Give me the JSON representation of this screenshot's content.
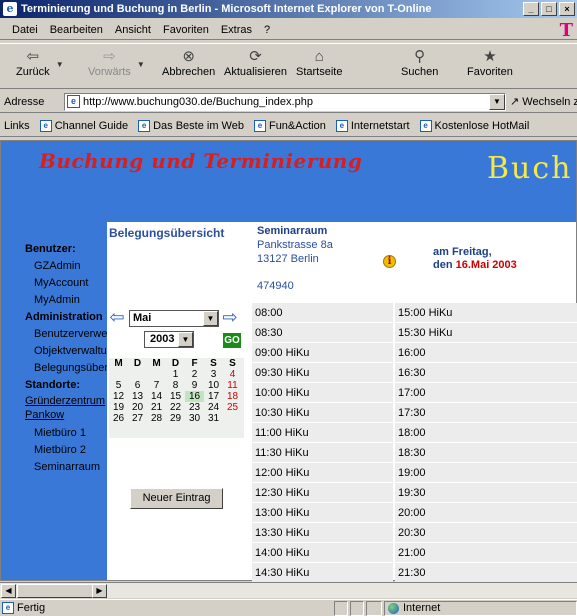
{
  "window": {
    "title": "Terminierung und Buchung in Berlin - Microsoft Internet Explorer von T-Online",
    "buttons": [
      "_",
      "□",
      "×"
    ]
  },
  "menu": [
    "Datei",
    "Bearbeiten",
    "Ansicht",
    "Favoriten",
    "Extras",
    "?"
  ],
  "menu_logo": "T",
  "toolbar": {
    "back": "Zurück",
    "forward": "Vorwärts",
    "stop": "Abbrechen",
    "refresh": "Aktualisieren",
    "home": "Startseite",
    "search": "Suchen",
    "favorites": "Favoriten"
  },
  "address": {
    "label": "Adresse",
    "url": "http://www.buchung030.de/Buchung_index.php",
    "go": "Wechseln zu"
  },
  "links": {
    "label": "Links",
    "items": [
      "Channel Guide",
      "Das Beste im Web",
      "Fun&Action",
      "Internetstart",
      "Kostenlose HotMail"
    ]
  },
  "page": {
    "brand_title": "Buchung und Terminierung",
    "brand_right": "Buch",
    "panel_title": "Belegungsübersicht",
    "room": {
      "name": "Seminarraum",
      "street": "Pankstrasse 8a",
      "city": "13127 Berlin",
      "zip_code": "474940"
    },
    "date_line1": "am Freitag,",
    "date_prefix": "den",
    "date_value": "16.Mai 2003",
    "info_icon": "i",
    "new_entry": "Neuer Eintrag"
  },
  "nav": {
    "benutzer_head": "Benutzer:",
    "benutzer_items": [
      "GZAdmin",
      "MyAccount",
      "MyAdmin"
    ],
    "admin_head": "Administration",
    "admin_items": [
      "Benutzerverwe",
      "Objektverwaltu",
      "Belegungsüber"
    ],
    "standorte_head": "Standorte:",
    "standort_link": [
      "Gründerzentrum",
      "Pankow"
    ],
    "standort_items": [
      "Mietbüro 1",
      "Mietbüro 2",
      "Seminarraum"
    ]
  },
  "calendar": {
    "month": "Mai",
    "year": "2003",
    "go": "GO",
    "headers": [
      "M",
      "D",
      "M",
      "D",
      "F",
      "S",
      "S"
    ],
    "weeks": [
      [
        "",
        "",
        "",
        "1",
        "2",
        "3",
        "4"
      ],
      [
        "5",
        "6",
        "7",
        "8",
        "9",
        "10",
        "11"
      ],
      [
        "12",
        "13",
        "14",
        "15",
        "16",
        "17",
        "18"
      ],
      [
        "19",
        "20",
        "21",
        "22",
        "23",
        "24",
        "25"
      ],
      [
        "26",
        "27",
        "28",
        "29",
        "30",
        "31",
        ""
      ]
    ],
    "today": "16"
  },
  "slots_left": [
    "08:00",
    "08:30",
    "09:00 HiKu",
    "09:30 HiKu",
    "10:00 HiKu",
    "10:30 HiKu",
    "11:00 HiKu",
    "11:30 HiKu",
    "12:00 HiKu",
    "12:30 HiKu",
    "13:00 HiKu",
    "13:30 HiKu",
    "14:00 HiKu",
    "14:30 HiKu"
  ],
  "slots_right": [
    "15:00 HiKu",
    "15:30 HiKu",
    "16:00",
    "16:30",
    "17:00",
    "17:30",
    "18:00",
    "18:30",
    "19:00",
    "19:30",
    "20:00",
    "20:30",
    "21:00",
    "21:30"
  ],
  "status": {
    "text": "Fertig",
    "zone": "Internet"
  }
}
